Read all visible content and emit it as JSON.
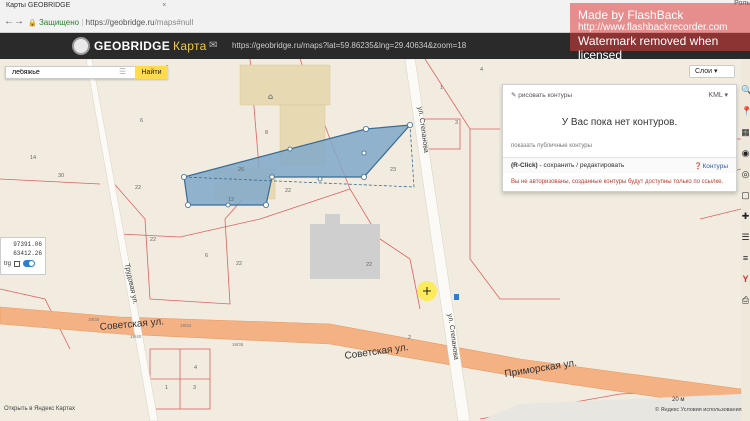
{
  "browser": {
    "tab_title": "Карты GEOBRIDGE",
    "tab_close": "×",
    "user_name": "Роль",
    "security_label": "Защищено",
    "url_prefix": "https://geobridge.ru",
    "url_path": "/maps#null",
    "back_glyph": "←",
    "forward_glyph": "→",
    "reload_glyph": "⟳",
    "lock_glyph": "🔒"
  },
  "watermark": {
    "line1": "Made by FlashBack",
    "line2": "http://www.flashbackrecorder.com",
    "line3": "Watermark removed when licensed"
  },
  "app": {
    "logo_text": "GEOBRIDGE",
    "logo_suffix": "Карта",
    "share_glyph": "✉",
    "url_display": "https://geobridge.ru/maps?lat=59.86235&lng=29.40634&zoom=18"
  },
  "search": {
    "value": "лебяжье",
    "placeholder": "",
    "clear_glyph": "☰",
    "button_label": "Найти"
  },
  "layers": {
    "label": "Слои ▾"
  },
  "coords": {
    "line1": "97391.06",
    "line2": "63412.26",
    "trg_label": "trg"
  },
  "panel": {
    "draw_label": "✎ рисовать контуры",
    "kml_label": "KML ▾",
    "empty_text": "У Вас пока нет контуров.",
    "public_link": "показать публичные контуры",
    "hint_bold": "(R-Click)",
    "hint_rest": " - сохранить / редактировать",
    "contours_link": "❓Контуры",
    "warning": "Вы не авторизованы, созданные контуры будут доступны только по ссылке."
  },
  "toolbar_icons": [
    "search-icon",
    "pin-icon",
    "grid-icon",
    "globe-icon",
    "target-icon",
    "square-icon",
    "cross-icon",
    "list-icon",
    "hamburger-icon",
    "yandex-icon",
    "print-icon"
  ],
  "toolbar_glyphs": [
    "🔍",
    "📍",
    "▦",
    "◉",
    "◎",
    "▢",
    "✚",
    "☰",
    "≡",
    "Y",
    "⎙"
  ],
  "map_labels": {
    "streets": [
      "Советская ул.",
      "Советская ул.",
      "Приморская ул.",
      "Трудовая ул.",
      "ул. Степанова",
      "ул. Степанова"
    ],
    "house_numbers": [
      "4",
      "6",
      "8",
      "22",
      "26",
      "22",
      "12",
      "23",
      "1",
      "3",
      "4",
      "30",
      "22",
      "6",
      "14",
      "22",
      "2",
      "22",
      "4",
      "1",
      "3"
    ],
    "small_labels": [
      "19/35",
      "19/34",
      "19/40",
      "19/36"
    ]
  },
  "attribution": {
    "left": "Открыть в Яндекс Картах",
    "right": "© Яндекс  Условия использования",
    "scale": "20 м"
  }
}
